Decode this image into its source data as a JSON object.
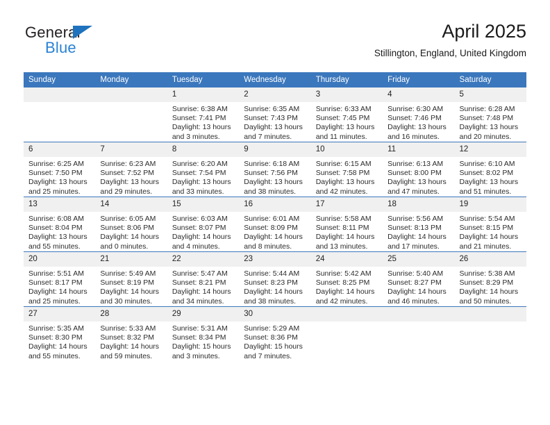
{
  "brand": {
    "name_top": "General",
    "name_bottom": "Blue"
  },
  "header": {
    "title": "April 2025",
    "subtitle": "Stillington, England, United Kingdom"
  },
  "colors": {
    "header_blue": "#3b77bc",
    "logo_blue": "#2a82d4",
    "logo_triangle": "#1f72bd",
    "daynum_band": "#f0f0f0"
  },
  "weekday_headers": [
    "Sunday",
    "Monday",
    "Tuesday",
    "Wednesday",
    "Thursday",
    "Friday",
    "Saturday"
  ],
  "labels": {
    "sunrise": "Sunrise:",
    "sunset": "Sunset:",
    "daylight": "Daylight:"
  },
  "weeks": [
    [
      {
        "day": "",
        "empty": true,
        "sunrise": "",
        "sunset": "",
        "daylight": ""
      },
      {
        "day": "",
        "empty": true,
        "sunrise": "",
        "sunset": "",
        "daylight": ""
      },
      {
        "day": "1",
        "sunrise": "Sunrise: 6:38 AM",
        "sunset": "Sunset: 7:41 PM",
        "daylight": "Daylight: 13 hours and 3 minutes."
      },
      {
        "day": "2",
        "sunrise": "Sunrise: 6:35 AM",
        "sunset": "Sunset: 7:43 PM",
        "daylight": "Daylight: 13 hours and 7 minutes."
      },
      {
        "day": "3",
        "sunrise": "Sunrise: 6:33 AM",
        "sunset": "Sunset: 7:45 PM",
        "daylight": "Daylight: 13 hours and 11 minutes."
      },
      {
        "day": "4",
        "sunrise": "Sunrise: 6:30 AM",
        "sunset": "Sunset: 7:46 PM",
        "daylight": "Daylight: 13 hours and 16 minutes."
      },
      {
        "day": "5",
        "sunrise": "Sunrise: 6:28 AM",
        "sunset": "Sunset: 7:48 PM",
        "daylight": "Daylight: 13 hours and 20 minutes."
      }
    ],
    [
      {
        "day": "6",
        "sunrise": "Sunrise: 6:25 AM",
        "sunset": "Sunset: 7:50 PM",
        "daylight": "Daylight: 13 hours and 25 minutes."
      },
      {
        "day": "7",
        "sunrise": "Sunrise: 6:23 AM",
        "sunset": "Sunset: 7:52 PM",
        "daylight": "Daylight: 13 hours and 29 minutes."
      },
      {
        "day": "8",
        "sunrise": "Sunrise: 6:20 AM",
        "sunset": "Sunset: 7:54 PM",
        "daylight": "Daylight: 13 hours and 33 minutes."
      },
      {
        "day": "9",
        "sunrise": "Sunrise: 6:18 AM",
        "sunset": "Sunset: 7:56 PM",
        "daylight": "Daylight: 13 hours and 38 minutes."
      },
      {
        "day": "10",
        "sunrise": "Sunrise: 6:15 AM",
        "sunset": "Sunset: 7:58 PM",
        "daylight": "Daylight: 13 hours and 42 minutes."
      },
      {
        "day": "11",
        "sunrise": "Sunrise: 6:13 AM",
        "sunset": "Sunset: 8:00 PM",
        "daylight": "Daylight: 13 hours and 47 minutes."
      },
      {
        "day": "12",
        "sunrise": "Sunrise: 6:10 AM",
        "sunset": "Sunset: 8:02 PM",
        "daylight": "Daylight: 13 hours and 51 minutes."
      }
    ],
    [
      {
        "day": "13",
        "sunrise": "Sunrise: 6:08 AM",
        "sunset": "Sunset: 8:04 PM",
        "daylight": "Daylight: 13 hours and 55 minutes."
      },
      {
        "day": "14",
        "sunrise": "Sunrise: 6:05 AM",
        "sunset": "Sunset: 8:06 PM",
        "daylight": "Daylight: 14 hours and 0 minutes."
      },
      {
        "day": "15",
        "sunrise": "Sunrise: 6:03 AM",
        "sunset": "Sunset: 8:07 PM",
        "daylight": "Daylight: 14 hours and 4 minutes."
      },
      {
        "day": "16",
        "sunrise": "Sunrise: 6:01 AM",
        "sunset": "Sunset: 8:09 PM",
        "daylight": "Daylight: 14 hours and 8 minutes."
      },
      {
        "day": "17",
        "sunrise": "Sunrise: 5:58 AM",
        "sunset": "Sunset: 8:11 PM",
        "daylight": "Daylight: 14 hours and 13 minutes."
      },
      {
        "day": "18",
        "sunrise": "Sunrise: 5:56 AM",
        "sunset": "Sunset: 8:13 PM",
        "daylight": "Daylight: 14 hours and 17 minutes."
      },
      {
        "day": "19",
        "sunrise": "Sunrise: 5:54 AM",
        "sunset": "Sunset: 8:15 PM",
        "daylight": "Daylight: 14 hours and 21 minutes."
      }
    ],
    [
      {
        "day": "20",
        "sunrise": "Sunrise: 5:51 AM",
        "sunset": "Sunset: 8:17 PM",
        "daylight": "Daylight: 14 hours and 25 minutes."
      },
      {
        "day": "21",
        "sunrise": "Sunrise: 5:49 AM",
        "sunset": "Sunset: 8:19 PM",
        "daylight": "Daylight: 14 hours and 30 minutes."
      },
      {
        "day": "22",
        "sunrise": "Sunrise: 5:47 AM",
        "sunset": "Sunset: 8:21 PM",
        "daylight": "Daylight: 14 hours and 34 minutes."
      },
      {
        "day": "23",
        "sunrise": "Sunrise: 5:44 AM",
        "sunset": "Sunset: 8:23 PM",
        "daylight": "Daylight: 14 hours and 38 minutes."
      },
      {
        "day": "24",
        "sunrise": "Sunrise: 5:42 AM",
        "sunset": "Sunset: 8:25 PM",
        "daylight": "Daylight: 14 hours and 42 minutes."
      },
      {
        "day": "25",
        "sunrise": "Sunrise: 5:40 AM",
        "sunset": "Sunset: 8:27 PM",
        "daylight": "Daylight: 14 hours and 46 minutes."
      },
      {
        "day": "26",
        "sunrise": "Sunrise: 5:38 AM",
        "sunset": "Sunset: 8:29 PM",
        "daylight": "Daylight: 14 hours and 50 minutes."
      }
    ],
    [
      {
        "day": "27",
        "sunrise": "Sunrise: 5:35 AM",
        "sunset": "Sunset: 8:30 PM",
        "daylight": "Daylight: 14 hours and 55 minutes."
      },
      {
        "day": "28",
        "sunrise": "Sunrise: 5:33 AM",
        "sunset": "Sunset: 8:32 PM",
        "daylight": "Daylight: 14 hours and 59 minutes."
      },
      {
        "day": "29",
        "sunrise": "Sunrise: 5:31 AM",
        "sunset": "Sunset: 8:34 PM",
        "daylight": "Daylight: 15 hours and 3 minutes."
      },
      {
        "day": "30",
        "sunrise": "Sunrise: 5:29 AM",
        "sunset": "Sunset: 8:36 PM",
        "daylight": "Daylight: 15 hours and 7 minutes."
      },
      {
        "day": "",
        "empty": true,
        "sunrise": "",
        "sunset": "",
        "daylight": ""
      },
      {
        "day": "",
        "empty": true,
        "sunrise": "",
        "sunset": "",
        "daylight": ""
      },
      {
        "day": "",
        "empty": true,
        "sunrise": "",
        "sunset": "",
        "daylight": ""
      }
    ]
  ]
}
